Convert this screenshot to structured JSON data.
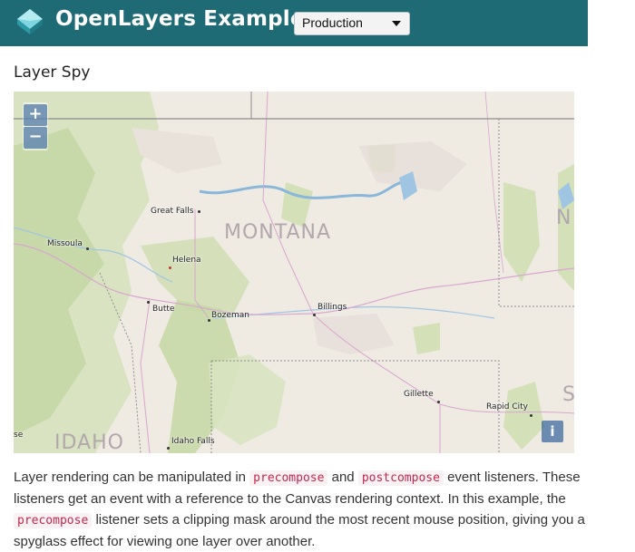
{
  "header": {
    "brand": "OpenLayers Examples",
    "version_select": {
      "value": "Production"
    }
  },
  "page_title": "Layer Spy",
  "map": {
    "zoom_in_label": "+",
    "zoom_out_label": "−",
    "attribution_label": "i",
    "state_labels": {
      "montana": "MONTANA",
      "idaho": "IDAHO",
      "north": "N",
      "south": "S"
    },
    "cities": {
      "great_falls": "Great Falls",
      "missoula": "Missoula",
      "helena": "Helena",
      "butte": "Butte",
      "bozeman": "Bozeman",
      "billings": "Billings",
      "gillette": "Gillette",
      "rapid_city": "Rapid City",
      "idaho_falls": "Idaho Falls",
      "edge_se": "se"
    }
  },
  "description": {
    "part1": "Layer rendering can be manipulated in ",
    "code1": "precompose",
    "part2": " and ",
    "code2": "postcompose",
    "part3": " event listeners. These listeners get an event with a reference to the Canvas rendering context. In this example, the ",
    "code3": "precompose",
    "part4": " listener sets a clipping mask around the most recent mouse position, giving you a spyglass effect for viewing one layer over another."
  }
}
